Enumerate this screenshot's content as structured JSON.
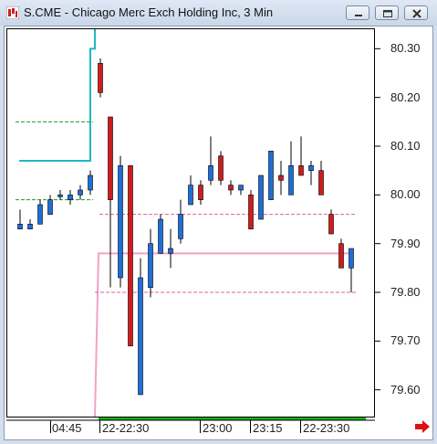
{
  "window": {
    "title": "S.CME - Chicago Merc Exch Holding Inc, 3 Min",
    "buttons": [
      "minimize",
      "restore",
      "close"
    ]
  },
  "chart_data": {
    "type": "candlestick",
    "symbol": "S.CME",
    "interval": "3 Min",
    "y_ticks": [
      "80.30",
      "80.20",
      "80.10",
      "80.00",
      "79.90",
      "79.80",
      "79.70",
      "79.60"
    ],
    "ylim": [
      79.545,
      80.34
    ],
    "x_labels": [
      "04:45",
      "22-22:30",
      "23:00",
      "23:15",
      "22-23:30"
    ],
    "colors": {
      "up": "#1e6fd9",
      "down": "#d01c1c",
      "wick": "#000000",
      "high_line": "#20b8c0",
      "low_line": "#f4a0c8",
      "green_level": "#1a9a2a",
      "pink_level": "#e060a0",
      "timebar": "#19b019"
    },
    "candles_pre": [
      {
        "o": 79.93,
        "h": 79.97,
        "l": 79.93,
        "c": 79.94,
        "dir": "up"
      },
      {
        "o": 79.93,
        "h": 79.95,
        "l": 79.93,
        "c": 79.94,
        "dir": "up"
      },
      {
        "o": 79.94,
        "h": 79.99,
        "l": 79.94,
        "c": 79.98,
        "dir": "up"
      },
      {
        "o": 79.96,
        "h": 80.0,
        "l": 79.96,
        "c": 79.99,
        "dir": "up"
      },
      {
        "o": 80.0,
        "h": 80.01,
        "l": 79.99,
        "c": 80.0,
        "dir": "up"
      },
      {
        "o": 79.99,
        "h": 80.01,
        "l": 79.98,
        "c": 80.0,
        "dir": "up"
      },
      {
        "o": 80.0,
        "h": 80.02,
        "l": 79.99,
        "c": 80.01,
        "dir": "up"
      },
      {
        "o": 80.01,
        "h": 80.05,
        "l": 80.0,
        "c": 80.04,
        "dir": "up"
      }
    ],
    "candles_main": [
      {
        "o": 80.27,
        "h": 80.28,
        "l": 80.2,
        "c": 80.21,
        "dir": "down"
      },
      {
        "o": 80.16,
        "h": 80.16,
        "l": 79.81,
        "c": 79.99,
        "dir": "down"
      },
      {
        "o": 79.83,
        "h": 80.08,
        "l": 79.81,
        "c": 80.06,
        "dir": "up"
      },
      {
        "o": 80.06,
        "h": 80.06,
        "l": 79.69,
        "c": 79.69,
        "dir": "down"
      },
      {
        "o": 79.59,
        "h": 79.87,
        "l": 79.59,
        "c": 79.83,
        "dir": "up"
      },
      {
        "o": 79.81,
        "h": 79.93,
        "l": 79.79,
        "c": 79.9,
        "dir": "up"
      },
      {
        "o": 79.88,
        "h": 79.96,
        "l": 79.88,
        "c": 79.95,
        "dir": "up"
      },
      {
        "o": 79.88,
        "h": 79.93,
        "l": 79.85,
        "c": 79.89,
        "dir": "up"
      },
      {
        "o": 79.91,
        "h": 79.99,
        "l": 79.9,
        "c": 79.96,
        "dir": "up"
      },
      {
        "o": 79.98,
        "h": 80.04,
        "l": 79.98,
        "c": 80.02,
        "dir": "up"
      },
      {
        "o": 80.02,
        "h": 80.03,
        "l": 79.98,
        "c": 79.99,
        "dir": "down"
      },
      {
        "o": 80.03,
        "h": 80.12,
        "l": 80.02,
        "c": 80.06,
        "dir": "up"
      },
      {
        "o": 80.08,
        "h": 80.09,
        "l": 80.02,
        "c": 80.03,
        "dir": "down"
      },
      {
        "o": 80.02,
        "h": 80.03,
        "l": 80.0,
        "c": 80.01,
        "dir": "down"
      },
      {
        "o": 80.01,
        "h": 80.02,
        "l": 80.0,
        "c": 80.02,
        "dir": "up"
      },
      {
        "o": 80.0,
        "h": 80.01,
        "l": 79.93,
        "c": 79.93,
        "dir": "down"
      },
      {
        "o": 79.95,
        "h": 80.04,
        "l": 79.95,
        "c": 80.04,
        "dir": "up"
      },
      {
        "o": 79.99,
        "h": 80.09,
        "l": 79.99,
        "c": 80.09,
        "dir": "up"
      },
      {
        "o": 80.04,
        "h": 80.07,
        "l": 80.0,
        "c": 80.03,
        "dir": "down"
      },
      {
        "o": 80.0,
        "h": 80.11,
        "l": 80.0,
        "c": 80.06,
        "dir": "up"
      },
      {
        "o": 80.06,
        "h": 80.12,
        "l": 80.05,
        "c": 80.04,
        "dir": "down"
      },
      {
        "o": 80.05,
        "h": 80.07,
        "l": 80.02,
        "c": 80.06,
        "dir": "up"
      },
      {
        "o": 80.05,
        "h": 80.07,
        "l": 80.0,
        "c": 80.0,
        "dir": "down"
      },
      {
        "o": 79.96,
        "h": 79.97,
        "l": 79.92,
        "c": 79.92,
        "dir": "down"
      },
      {
        "o": 79.9,
        "h": 79.91,
        "l": 79.85,
        "c": 79.85,
        "dir": "down"
      },
      {
        "o": 79.85,
        "h": 79.89,
        "l": 79.8,
        "c": 79.89,
        "dir": "up"
      }
    ],
    "levels": {
      "prev_high": 80.07,
      "prev_green_high": 80.15,
      "prev_green_low": 79.99,
      "main_high": 80.34,
      "main_pink_upper": 79.96,
      "main_pink_mid": 79.88,
      "main_pink_lower": 79.8
    }
  }
}
